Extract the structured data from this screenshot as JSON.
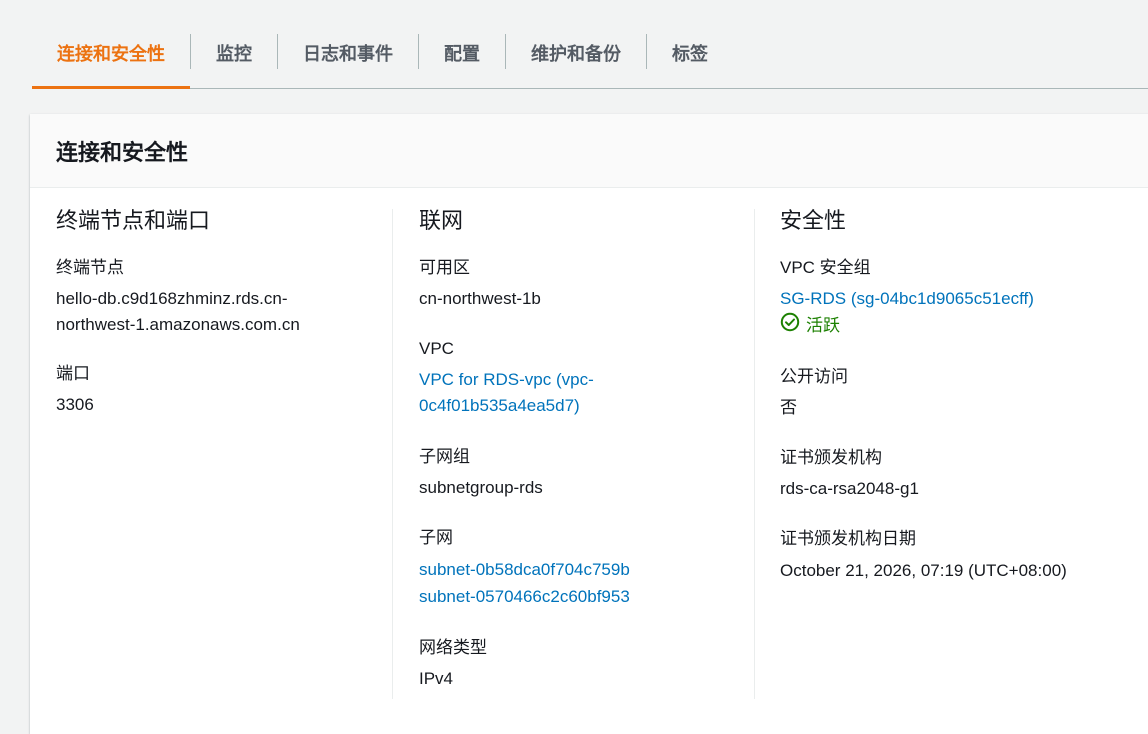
{
  "tabs": [
    {
      "label": "连接和安全性"
    },
    {
      "label": "监控"
    },
    {
      "label": "日志和事件"
    },
    {
      "label": "配置"
    },
    {
      "label": "维护和备份"
    },
    {
      "label": "标签"
    }
  ],
  "panel": {
    "title": "连接和安全性",
    "endpoint_section": {
      "heading": "终端节点和端口",
      "endpoint_label": "终端节点",
      "endpoint_line1": "hello-db.c9d168zhminz.rds.cn-",
      "endpoint_line2": "northwest-1.amazonaws.com.cn",
      "port_label": "端口",
      "port_value": "3306"
    },
    "network_section": {
      "heading": "联网",
      "az_label": "可用区",
      "az_value": "cn-northwest-1b",
      "vpc_label": "VPC",
      "vpc_line1": "VPC for RDS-vpc (vpc-",
      "vpc_line2": "0c4f01b535a4ea5d7)",
      "subnet_group_label": "子网组",
      "subnet_group_value": "subnetgroup-rds",
      "subnets_label": "子网",
      "subnets": [
        "subnet-0b58dca0f704c759b",
        "subnet-0570466c2c60bf953"
      ],
      "network_type_label": "网络类型",
      "network_type_value": "IPv4"
    },
    "security_section": {
      "heading": "安全性",
      "sg_label": "VPC 安全组",
      "sg_value": "SG-RDS (sg-04bc1d9065c51ecff)",
      "sg_status": "活跃",
      "public_label": "公开访问",
      "public_value": "否",
      "ca_label": "证书颁发机构",
      "ca_value": "rds-ca-rsa2048-g1",
      "ca_date_label": "证书颁发机构日期",
      "ca_date_value": "October 21, 2026, 07:19 (UTC+08:00)"
    }
  },
  "colors": {
    "accent": "#ec7211",
    "link": "#0073bb",
    "success": "#1d8102"
  }
}
